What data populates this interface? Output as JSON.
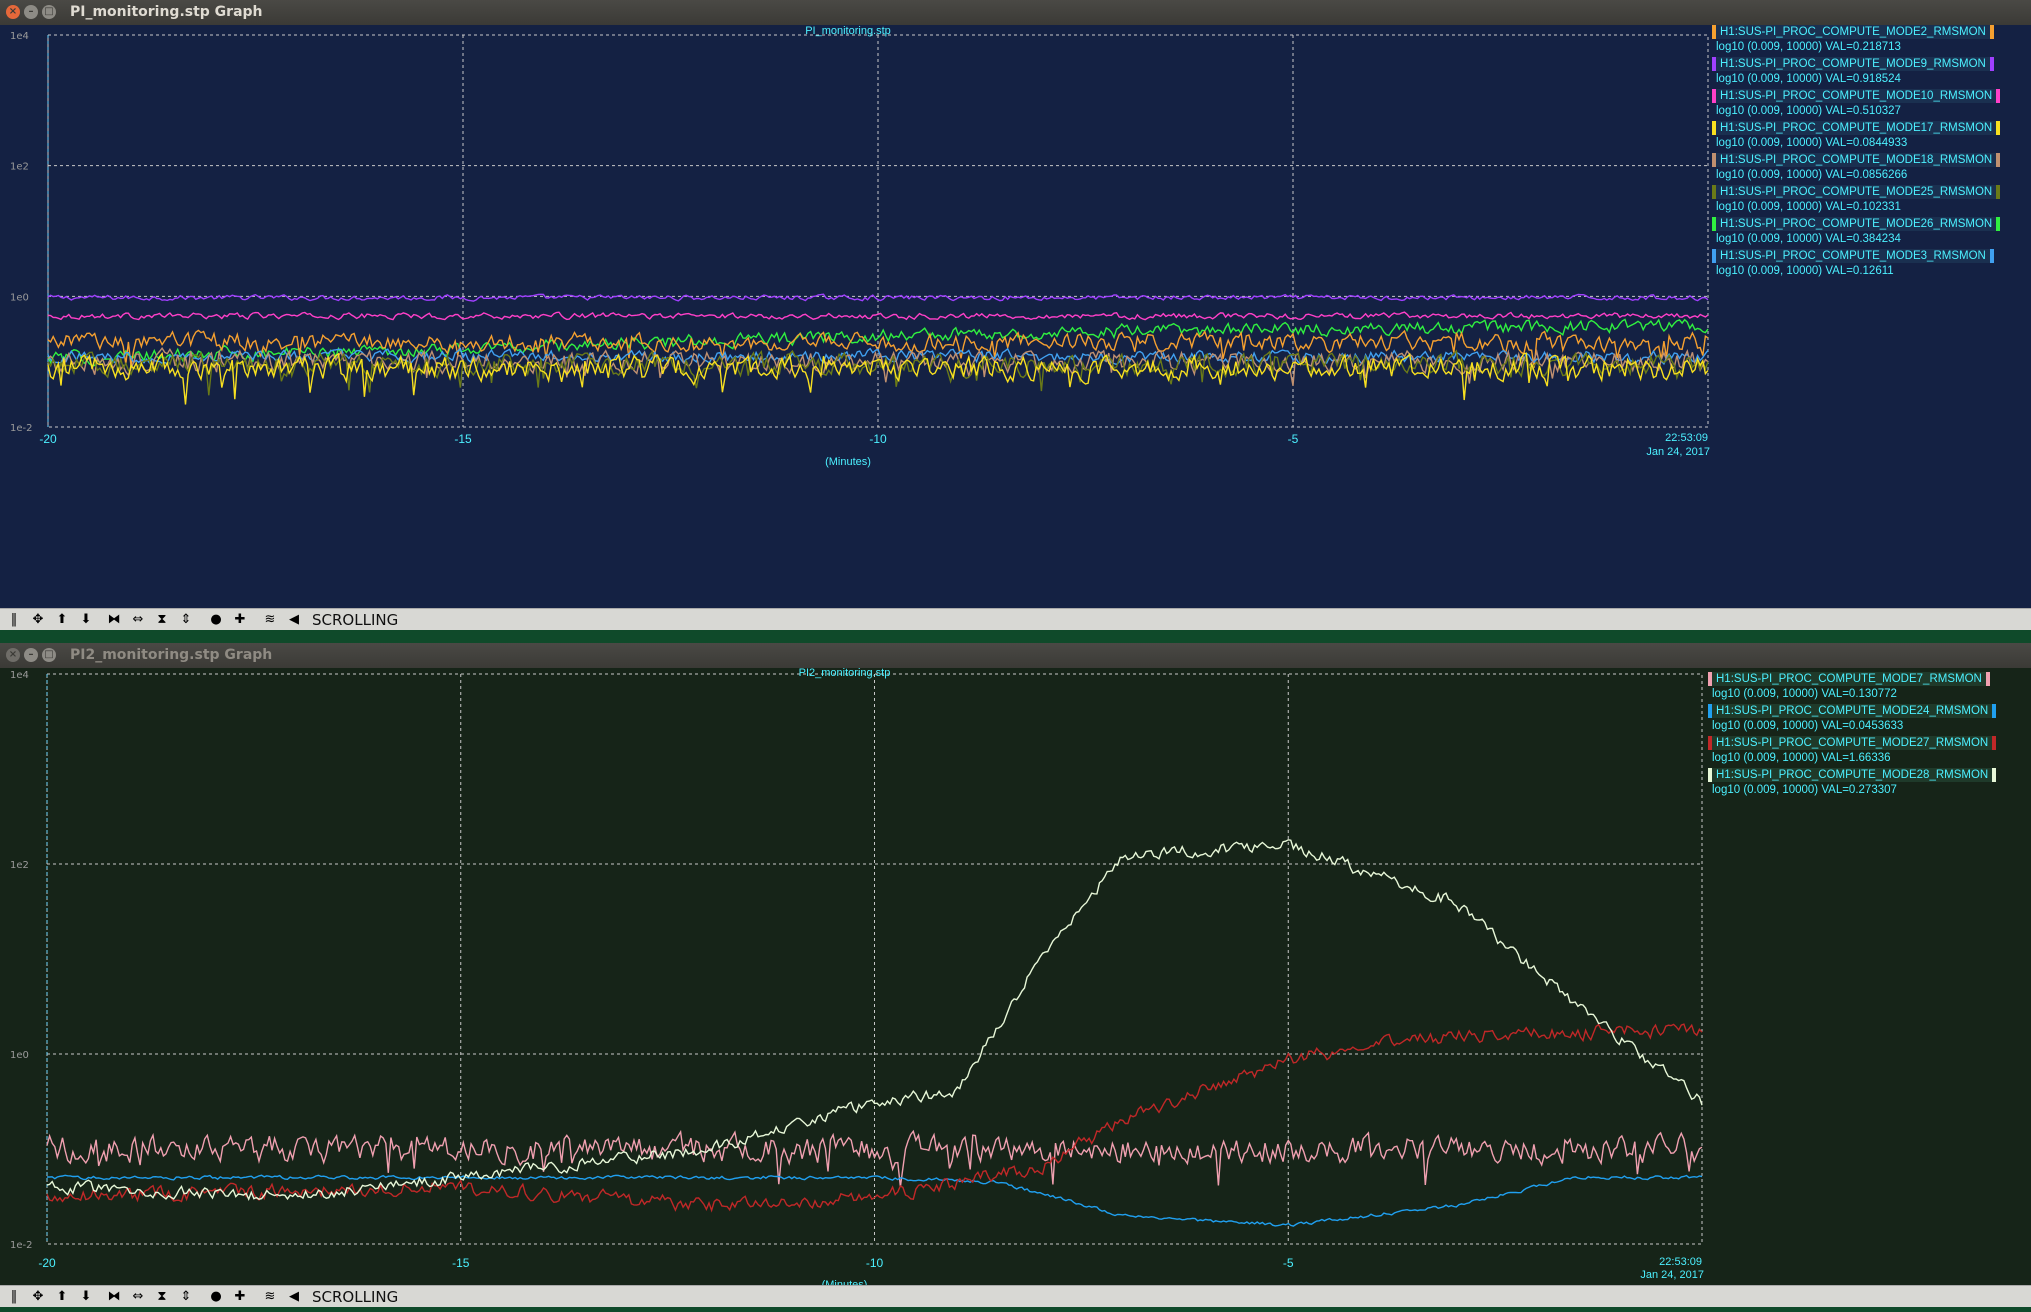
{
  "windows": [
    {
      "title": "PI_monitoring.stp Graph",
      "plot_title": "PI_monitoring.stp",
      "xlabel": "(Minutes)",
      "x_ticks": [
        "-20",
        "-15",
        "-10",
        "-5"
      ],
      "time_label": "22:53:09",
      "date_label": "Jan 24, 2017",
      "y_ticks": [
        "1e4",
        "1e2",
        "1e0",
        "1e-2"
      ],
      "legend": [
        {
          "name": "H1:SUS-PI_PROC_COMPUTE_MODE2_RMSMON",
          "range": "log10 (0.009, 10000) VAL=0.218713",
          "color": "#f5a030"
        },
        {
          "name": "H1:SUS-PI_PROC_COMPUTE_MODE9_RMSMON",
          "range": "log10 (0.009, 10000) VAL=0.918524",
          "color": "#a040ff"
        },
        {
          "name": "H1:SUS-PI_PROC_COMPUTE_MODE10_RMSMON",
          "range": "log10 (0.009, 10000) VAL=0.510327",
          "color": "#ff40c8"
        },
        {
          "name": "H1:SUS-PI_PROC_COMPUTE_MODE17_RMSMON",
          "range": "log10 (0.009, 10000) VAL=0.0844933",
          "color": "#f8e020"
        },
        {
          "name": "H1:SUS-PI_PROC_COMPUTE_MODE18_RMSMON",
          "range": "log10 (0.009, 10000) VAL=0.0856266",
          "color": "#c09070"
        },
        {
          "name": "H1:SUS-PI_PROC_COMPUTE_MODE25_RMSMON",
          "range": "log10 (0.009, 10000) VAL=0.102331",
          "color": "#6a7a18"
        },
        {
          "name": "H1:SUS-PI_PROC_COMPUTE_MODE26_RMSMON",
          "range": "log10 (0.009, 10000) VAL=0.384234",
          "color": "#30f040"
        },
        {
          "name": "H1:SUS-PI_PROC_COMPUTE_MODE3_RMSMON",
          "range": "log10 (0.009, 10000) VAL=0.12611",
          "color": "#40a0f0"
        }
      ],
      "toolbar_label": "SCROLLING"
    },
    {
      "title": "PI2_monitoring.stp Graph",
      "plot_title": "PI2_monitoring.stp",
      "xlabel": "(Minutes)",
      "x_ticks": [
        "-20",
        "-15",
        "-10",
        "-5"
      ],
      "time_label": "22:53:09",
      "date_label": "Jan 24, 2017",
      "y_ticks": [
        "1e4",
        "1e2",
        "1e0",
        "1e-2"
      ],
      "legend": [
        {
          "name": "H1:SUS-PI_PROC_COMPUTE_MODE7_RMSMON",
          "range": "log10 (0.009, 10000) VAL=0.130772",
          "color": "#f0a0b0"
        },
        {
          "name": "H1:SUS-PI_PROC_COMPUTE_MODE24_RMSMON",
          "range": "log10 (0.009, 10000) VAL=0.0453633",
          "color": "#20a0f0"
        },
        {
          "name": "H1:SUS-PI_PROC_COMPUTE_MODE27_RMSMON",
          "range": "log10 (0.009, 10000) VAL=1.66336",
          "color": "#c02828"
        },
        {
          "name": "H1:SUS-PI_PROC_COMPUTE_MODE28_RMSMON",
          "range": "log10 (0.009, 10000) VAL=0.273307",
          "color": "#e8f8d8"
        }
      ],
      "toolbar_label": "SCROLLING"
    }
  ],
  "chart_data": [
    {
      "type": "line",
      "title": "PI_monitoring.stp",
      "xlabel": "(Minutes)",
      "ylabel": "",
      "xlim": [
        -20,
        0
      ],
      "ylim": [
        -2,
        4
      ],
      "y_scale": "log10",
      "grid": true,
      "legend_position": "top-right",
      "series": [
        {
          "name": "H1:SUS-PI_PROC_COMPUTE_MODE9_RMSMON",
          "color": "#a040ff",
          "x": [
            -20,
            -15,
            -10,
            -5,
            0
          ],
          "y": [
            -0.02,
            -0.02,
            -0.02,
            -0.02,
            -0.02
          ]
        },
        {
          "name": "H1:SUS-PI_PROC_COMPUTE_MODE10_RMSMON",
          "color": "#ff40c8",
          "x": [
            -20,
            -15,
            -10,
            -5,
            0
          ],
          "y": [
            -0.3,
            -0.3,
            -0.3,
            -0.3,
            -0.3
          ]
        },
        {
          "name": "H1:SUS-PI_PROC_COMPUTE_MODE26_RMSMON",
          "color": "#30f040",
          "x": [
            -20,
            -15,
            -10,
            -5,
            0
          ],
          "y": [
            -0.95,
            -0.8,
            -0.6,
            -0.5,
            -0.45
          ]
        },
        {
          "name": "H1:SUS-PI_PROC_COMPUTE_MODE2_RMSMON",
          "color": "#f5a030",
          "x": [
            -20,
            -15,
            -10,
            -5,
            0
          ],
          "y": [
            -0.7,
            -0.7,
            -0.7,
            -0.7,
            -0.7
          ]
        },
        {
          "name": "H1:SUS-PI_PROC_COMPUTE_MODE3_RMSMON",
          "color": "#40a0f0",
          "x": [
            -20,
            -15,
            -10,
            -5,
            0
          ],
          "y": [
            -0.92,
            -0.92,
            -0.92,
            -0.92,
            -0.92
          ]
        },
        {
          "name": "H1:SUS-PI_PROC_COMPUTE_MODE18_RMSMON",
          "color": "#c09070",
          "x": [
            -20,
            -15,
            -10,
            -5,
            0
          ],
          "y": [
            -1.0,
            -1.0,
            -1.0,
            -1.0,
            -1.0
          ]
        },
        {
          "name": "H1:SUS-PI_PROC_COMPUTE_MODE25_RMSMON",
          "color": "#6a7a18",
          "x": [
            -20,
            -15,
            -10,
            -5,
            0
          ],
          "y": [
            -1.05,
            -1.05,
            -1.05,
            -1.05,
            -1.05
          ]
        },
        {
          "name": "H1:SUS-PI_PROC_COMPUTE_MODE17_RMSMON",
          "color": "#f8e020",
          "x": [
            -20,
            -15,
            -10,
            -5,
            0
          ],
          "y": [
            -1.1,
            -1.1,
            -1.1,
            -1.1,
            -1.1
          ]
        }
      ]
    },
    {
      "type": "line",
      "title": "PI2_monitoring.stp",
      "xlabel": "(Minutes)",
      "ylabel": "",
      "xlim": [
        -20,
        0
      ],
      "ylim": [
        -2,
        4
      ],
      "y_scale": "log10",
      "grid": true,
      "legend_position": "top-right",
      "series": [
        {
          "name": "H1:SUS-PI_PROC_COMPUTE_MODE7_RMSMON",
          "color": "#f0a0b0",
          "x": [
            -20,
            -15,
            -10,
            -5,
            0
          ],
          "y": [
            -1.0,
            -1.0,
            -1.0,
            -1.0,
            -1.0
          ]
        },
        {
          "name": "H1:SUS-PI_PROC_COMPUTE_MODE24_RMSMON",
          "color": "#20a0f0",
          "x": [
            -20,
            -15,
            -10,
            -8.5,
            -7,
            -5,
            -3,
            -1.5,
            0
          ],
          "y": [
            -1.3,
            -1.3,
            -1.3,
            -1.35,
            -1.7,
            -1.8,
            -1.6,
            -1.3,
            -1.3
          ]
        },
        {
          "name": "H1:SUS-PI_PROC_COMPUTE_MODE27_RMSMON",
          "color": "#c02828",
          "x": [
            -20,
            -15,
            -12,
            -10,
            -8,
            -7,
            -5,
            -3,
            0
          ],
          "y": [
            -1.5,
            -1.4,
            -1.6,
            -1.5,
            -1.2,
            -0.7,
            -0.05,
            0.2,
            0.25
          ]
        },
        {
          "name": "H1:SUS-PI_PROC_COMPUTE_MODE28_RMSMON",
          "color": "#e8f8d8",
          "x": [
            -20,
            -17,
            -15,
            -12,
            -10,
            -9,
            -8,
            -7,
            -5,
            -3,
            -1.5,
            0
          ],
          "y": [
            -1.4,
            -1.5,
            -1.3,
            -1.0,
            -0.5,
            -0.4,
            1.0,
            2.1,
            2.2,
            1.6,
            0.5,
            -0.5
          ]
        }
      ]
    }
  ]
}
